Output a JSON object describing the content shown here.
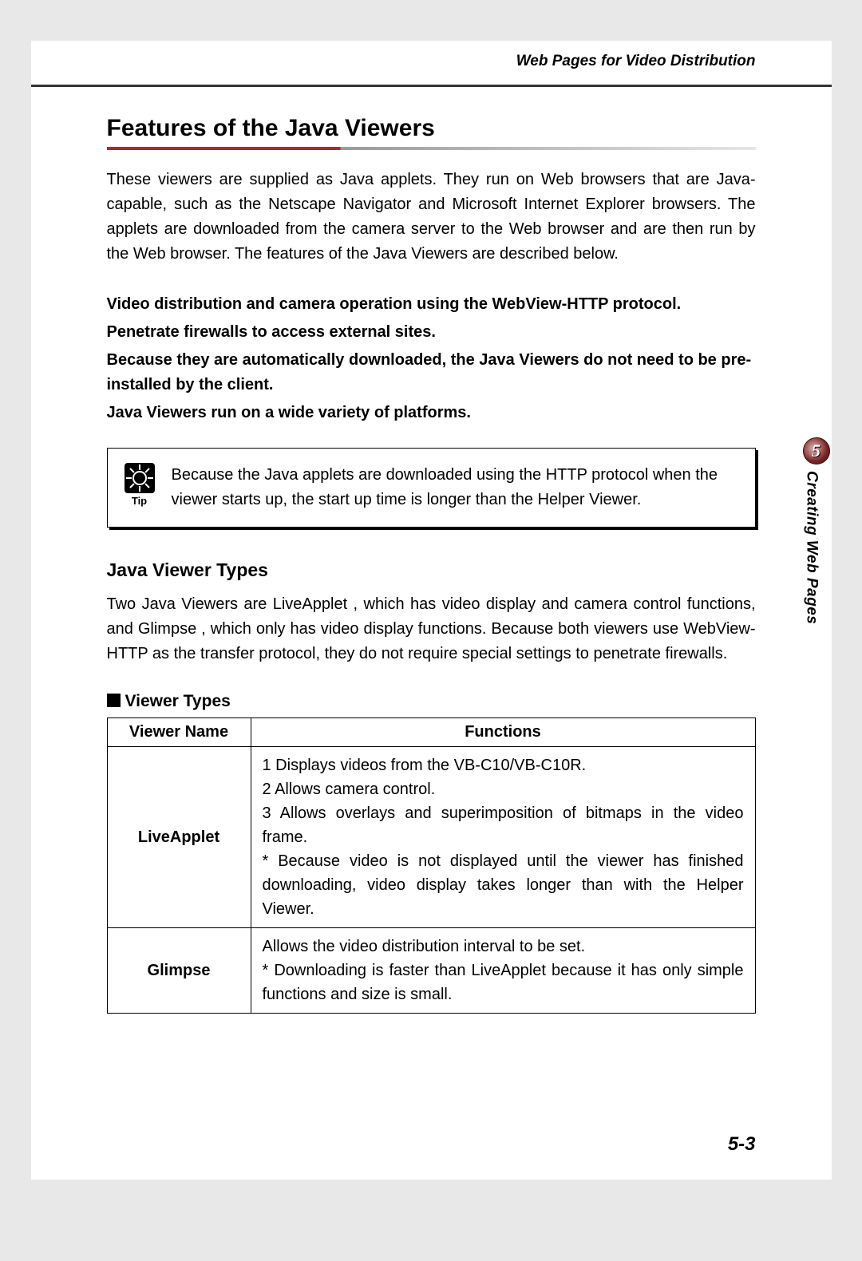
{
  "header": {
    "running_title": "Web Pages for Video Distribution"
  },
  "section": {
    "title": "Features of the Java Viewers",
    "intro": "These viewers are supplied as Java applets. They run on Web browsers that are Java-capable, such as the Netscape Navigator and Microsoft Internet Explorer browsers. The applets are downloaded from the camera server to the Web browser and are then run by the Web browser. The features of the Java Viewers are described below.",
    "features": {
      "f1": "Video distribution and camera operation using the WebView-HTTP protocol.",
      "f2": "Penetrate firewalls to access external sites.",
      "f3": "Because they are automatically downloaded, the Java Viewers do not need to be pre-installed by the client.",
      "f4": "Java Viewers run on a wide variety of platforms."
    },
    "tip": {
      "label": "Tip",
      "text": "Because the Java applets are downloaded using the HTTP protocol when the viewer starts up, the start up time is longer than the Helper Viewer."
    },
    "types": {
      "heading": "Java Viewer Types",
      "para": "Two Java Viewers are LiveApplet , which has video display and camera control functions, and Glimpse , which only has video display functions. Because both viewers use WebView-HTTP as the transfer protocol, they do not require special settings to penetrate firewalls.",
      "table_heading": "Viewer Types",
      "th1": "Viewer Name",
      "th2": "Functions",
      "rows": {
        "r1": {
          "name": "LiveApplet",
          "l1": "1  Displays videos from the VB-C10/VB-C10R.",
          "l2": "2  Allows camera control.",
          "l3": "3  Allows overlays and superimposition of bitmaps in the video frame.",
          "note": "* Because video is not displayed until the viewer has finished downloading, video display takes longer than with the Helper Viewer."
        },
        "r2": {
          "name": "Glimpse",
          "l1": "Allows the video distribution interval to be set.",
          "note": "* Downloading is faster than LiveApplet because it has only simple functions and size is small."
        }
      }
    }
  },
  "side": {
    "chapter_num": "5",
    "chapter_title": "Creating Web Pages"
  },
  "footer": {
    "page_number": "5-3"
  }
}
